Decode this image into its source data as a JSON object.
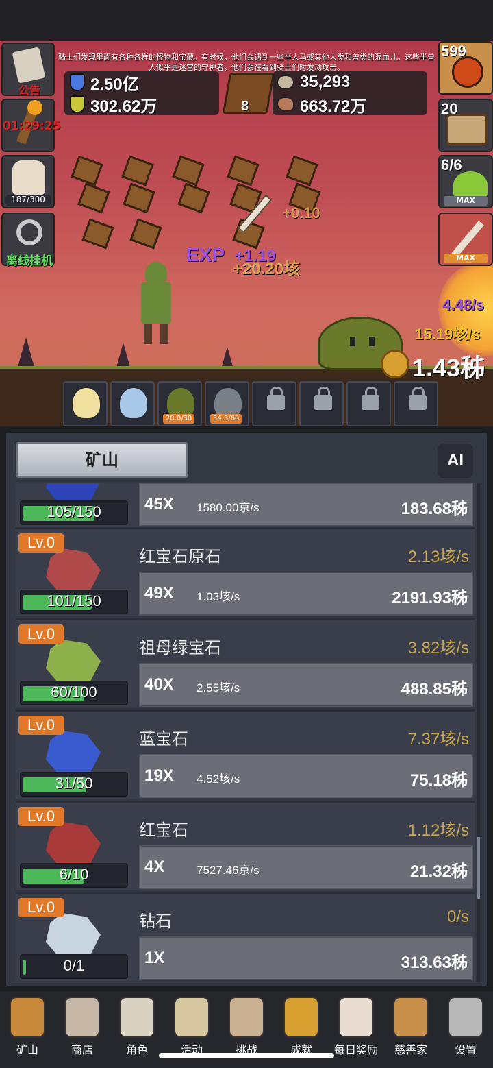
{
  "story_text": "骑士们发现里面有各种各样的怪物和宝藏。有时候，他们会遇到一些半人马或其他人类和兽类的混血儿。这些半兽人似乎是迷宫的守护者，他们会在看到骑士们时发动攻击。",
  "resources": {
    "blue_potion": "2.50亿",
    "yellow_potion": "302.62万",
    "book_count": "8",
    "stone": "35,293",
    "meat": "663.72万"
  },
  "left_buttons": {
    "notice_label": "公告",
    "torch_timer": "01:29:25",
    "lantern_progress": "187/300",
    "offline_label": "离线挂机"
  },
  "right_buttons": {
    "potion_count": "599",
    "chest_count": "20",
    "slime_count": "6/6",
    "slime_max": "MAX",
    "sword_max": "MAX"
  },
  "floating": {
    "plus_a": "+0.10",
    "exp_label": "EXP",
    "exp_gain": "+1.19",
    "gold_gain": "+20.20垓",
    "rate_purple": "4.48/s",
    "rate_gold": "15.19垓/s",
    "coin_total": "1.43秭"
  },
  "slots": [
    {
      "name": "candle",
      "tag": ""
    },
    {
      "name": "egg",
      "tag": ""
    },
    {
      "name": "slime-pet",
      "tag": "20.0/30"
    },
    {
      "name": "ghost-pet",
      "tag": "34.3/60"
    },
    {
      "name": "locked",
      "tag": ""
    },
    {
      "name": "locked",
      "tag": ""
    },
    {
      "name": "locked",
      "tag": ""
    },
    {
      "name": "locked",
      "tag": ""
    }
  ],
  "panel": {
    "tab_label": "矿山",
    "ai_label": "AI"
  },
  "mines": [
    {
      "name": "",
      "lv": "",
      "rate": "",
      "progress": "105/150",
      "fill": 0.7,
      "mult": "45X",
      "unit_rate": "1580.00京/s",
      "cost": "183.68秭",
      "color": "#2c44b8"
    },
    {
      "name": "红宝石原石",
      "lv": "Lv.0",
      "rate": "2.13垓/s",
      "progress": "101/150",
      "fill": 0.673,
      "mult": "49X",
      "unit_rate": "1.03垓/s",
      "cost": "2191.93秭",
      "color": "#b04a4a"
    },
    {
      "name": "祖母绿宝石",
      "lv": "Lv.0",
      "rate": "3.82垓/s",
      "progress": "60/100",
      "fill": 0.6,
      "mult": "40X",
      "unit_rate": "2.55垓/s",
      "cost": "488.85秭",
      "color": "#8db04a"
    },
    {
      "name": "蓝宝石",
      "lv": "Lv.0",
      "rate": "7.37垓/s",
      "progress": "31/50",
      "fill": 0.62,
      "mult": "19X",
      "unit_rate": "4.52垓/s",
      "cost": "75.18秭",
      "color": "#3a5ad0"
    },
    {
      "name": "红宝石",
      "lv": "Lv.0",
      "rate": "1.12垓/s",
      "progress": "6/10",
      "fill": 0.6,
      "mult": "4X",
      "unit_rate": "7527.46京/s",
      "cost": "21.32秭",
      "color": "#a83a3a"
    },
    {
      "name": "钻石",
      "lv": "Lv.0",
      "rate": "0/s",
      "progress": "0/1",
      "fill": 0.03,
      "mult": "1X",
      "unit_rate": "",
      "cost": "313.63秭",
      "color": "#c8d4e0"
    }
  ],
  "nav": [
    {
      "label": "矿山",
      "icon": "lantern-icon",
      "color": "#c88a3a"
    },
    {
      "label": "商店",
      "icon": "stone-icon",
      "color": "#c8b8a8"
    },
    {
      "label": "角色",
      "icon": "skull-icon",
      "color": "#d8d0c0"
    },
    {
      "label": "活动",
      "icon": "scroll-icon",
      "color": "#d8c8a0"
    },
    {
      "label": "挑战",
      "icon": "map-icon",
      "color": "#c8b090"
    },
    {
      "label": "成就",
      "icon": "key-icon",
      "color": "#d8a030"
    },
    {
      "label": "每日奖励",
      "icon": "letter-icon",
      "color": "#e8dcd0"
    },
    {
      "label": "慈善家",
      "icon": "bread-icon",
      "color": "#c8904a"
    },
    {
      "label": "设置",
      "icon": "gear-icon",
      "color": "#b8b8b8"
    }
  ]
}
